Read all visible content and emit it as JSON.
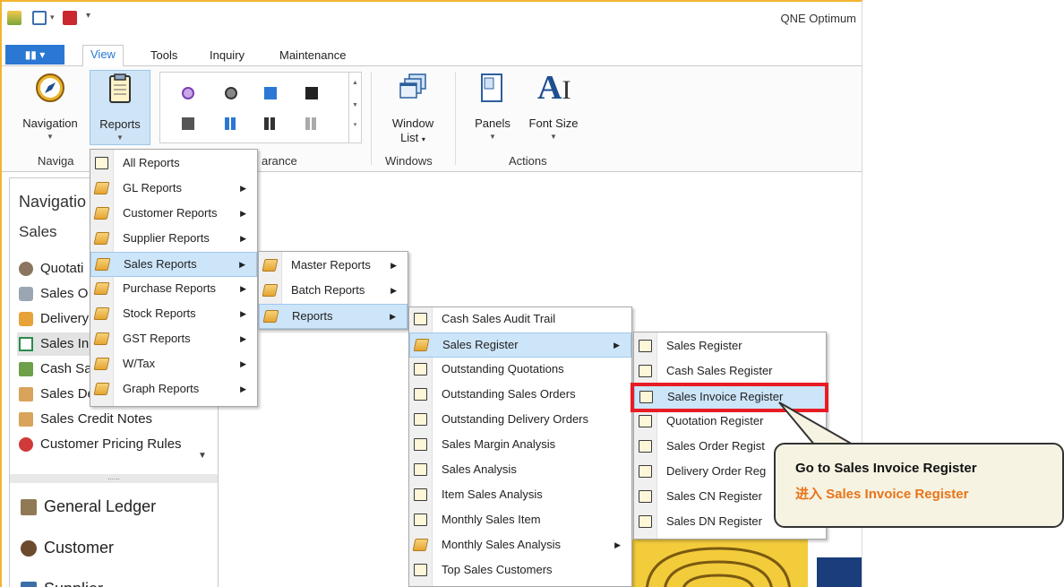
{
  "app": {
    "title": "QNE Optimum"
  },
  "quick_access": {
    "icons": [
      "qne-logo-icon",
      "document-dropdown-icon",
      "pdf-icon",
      "customize-quick-access-icon"
    ]
  },
  "ribbon": {
    "tabs": [
      "View",
      "Tools",
      "Inquiry",
      "Maintenance"
    ],
    "active_tab": "View",
    "buttons": {
      "navigation": "Navigation",
      "reports": "Reports",
      "window_list": "Window",
      "window_list_2": "List",
      "panels": "Panels",
      "font_size": "Font Size"
    },
    "groups": {
      "navigation": "Naviga",
      "appearance": "arance",
      "windows": "Windows",
      "actions": "Actions"
    }
  },
  "nav_pane": {
    "title": "Navigatio",
    "section": "Sales",
    "items": [
      "Quotati",
      "Sales O",
      "Delivery",
      "Sales In",
      "Cash Sa",
      "Sales Debit Notes",
      "Sales Credit Notes",
      "Customer Pricing Rules"
    ],
    "modules": [
      "General Ledger",
      "Customer",
      "Supplier"
    ]
  },
  "reports_menu": {
    "items": [
      "All Reports",
      "GL Reports",
      "Customer Reports",
      "Supplier Reports",
      "Sales Reports",
      "Purchase Reports",
      "Stock Reports",
      "GST Reports",
      "W/Tax",
      "Graph Reports"
    ]
  },
  "sales_reports_menu": {
    "items": [
      "Master Reports",
      "Batch Reports",
      "Reports"
    ]
  },
  "reports_submenu": {
    "items": [
      "Cash Sales Audit Trail",
      "Sales Register",
      "Outstanding Quotations",
      "Outstanding Sales Orders",
      "Outstanding Delivery Orders",
      "Sales Margin Analysis",
      "Sales Analysis",
      "Item Sales Analysis",
      "Monthly Sales Item",
      "Monthly Sales Analysis",
      "Top Sales Customers"
    ]
  },
  "sales_register_menu": {
    "items": [
      "Sales Register",
      "Cash Sales Register",
      "Sales Invoice Register",
      "Quotation Register",
      "Sales Order Regist",
      "Delivery Order Reg",
      "Sales CN Register",
      "Sales DN Register"
    ]
  },
  "callout": {
    "line_en": "Go to Sales Invoice Register",
    "line_cn_prefix": "进入 ",
    "line_cn_name": "Sales Invoice Register"
  },
  "colors": {
    "accent": "#2a78d3",
    "highlight": "#e81c24",
    "callout_cn": "#e8741a",
    "menu_hover": "#cde5f9"
  }
}
